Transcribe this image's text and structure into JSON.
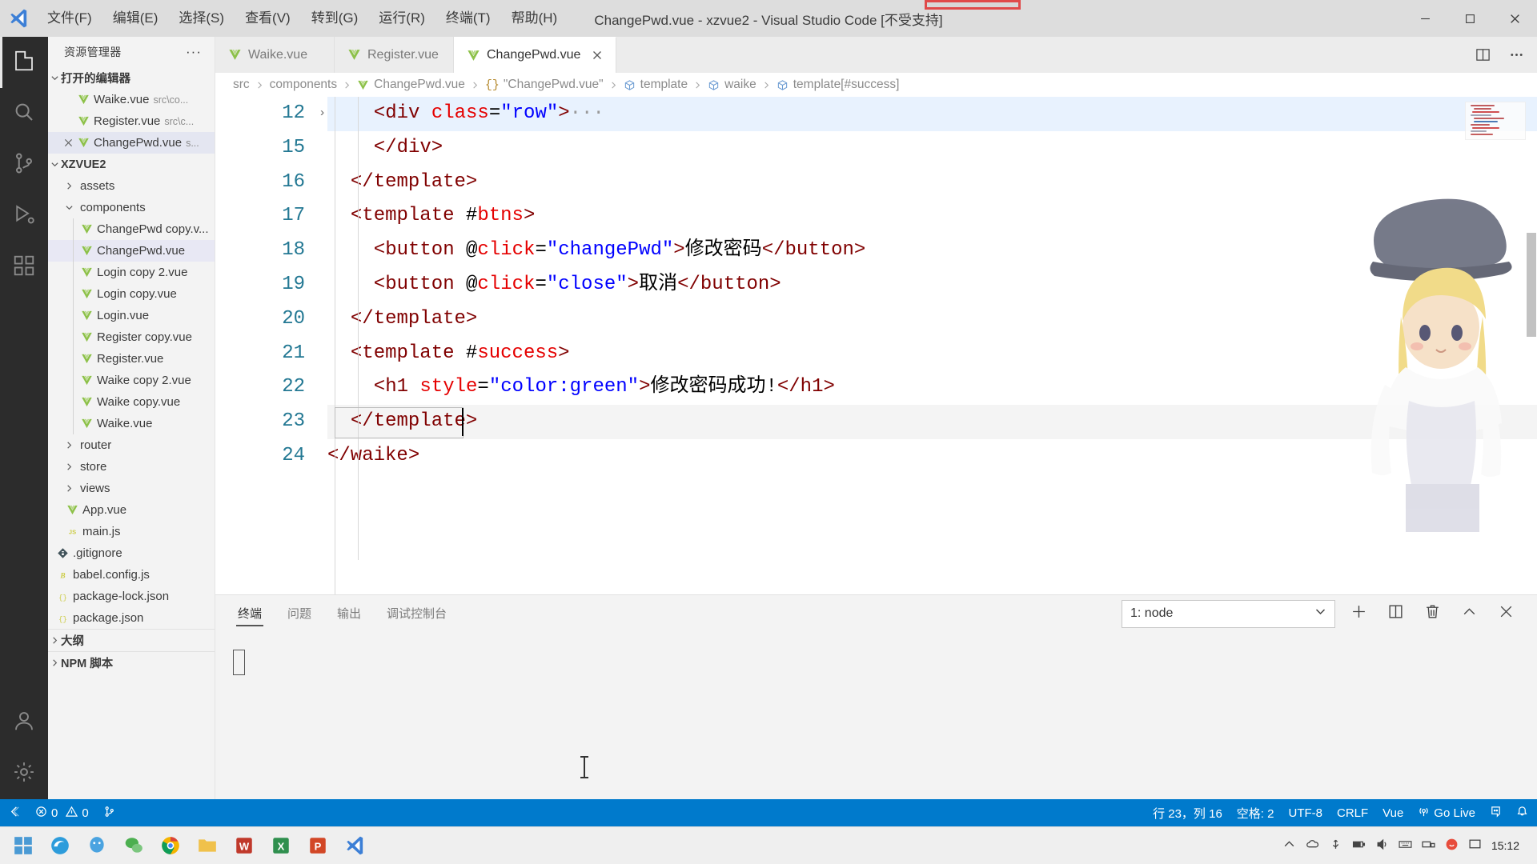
{
  "window": {
    "title": "ChangePwd.vue - xzvue2 - Visual Studio Code [不受支持]",
    "minimize": "─",
    "maximize": "□",
    "close": "✕"
  },
  "menu": [
    {
      "label": "文件(F)"
    },
    {
      "label": "编辑(E)"
    },
    {
      "label": "选择(S)"
    },
    {
      "label": "查看(V)"
    },
    {
      "label": "转到(G)"
    },
    {
      "label": "运行(R)"
    },
    {
      "label": "终端(T)"
    },
    {
      "label": "帮助(H)"
    }
  ],
  "activitybar": [
    {
      "name": "explorer-icon",
      "title": "资源管理器"
    },
    {
      "name": "search-icon",
      "title": "搜索"
    },
    {
      "name": "source-control-icon",
      "title": "源代码管理"
    },
    {
      "name": "run-debug-icon",
      "title": "运行和调试"
    },
    {
      "name": "extensions-icon",
      "title": "扩展"
    },
    {
      "name": "account-icon",
      "title": "账户"
    },
    {
      "name": "settings-gear-icon",
      "title": "管理"
    }
  ],
  "sidebar": {
    "header": "资源管理器",
    "header_more": "···",
    "open_editors": {
      "label": "打开的编辑器",
      "items": [
        {
          "name": "Waike.vue",
          "path": "src\\co...",
          "closable": false,
          "selected": false
        },
        {
          "name": "Register.vue",
          "path": "src\\c...",
          "closable": false,
          "selected": false
        },
        {
          "name": "ChangePwd.vue",
          "path": "s...",
          "closable": true,
          "selected": true
        }
      ]
    },
    "project": {
      "label": "XZVUE2",
      "items": [
        {
          "label": "assets",
          "type": "folder",
          "expanded": false,
          "indent": 1
        },
        {
          "label": "components",
          "type": "folder",
          "expanded": true,
          "indent": 1
        },
        {
          "label": "ChangePwd copy.v...",
          "type": "vue",
          "indent": 2
        },
        {
          "label": "ChangePwd.vue",
          "type": "vue",
          "indent": 2,
          "selected": true
        },
        {
          "label": "Login copy 2.vue",
          "type": "vue",
          "indent": 2
        },
        {
          "label": "Login copy.vue",
          "type": "vue",
          "indent": 2
        },
        {
          "label": "Login.vue",
          "type": "vue",
          "indent": 2
        },
        {
          "label": "Register copy.vue",
          "type": "vue",
          "indent": 2
        },
        {
          "label": "Register.vue",
          "type": "vue",
          "indent": 2
        },
        {
          "label": "Waike copy 2.vue",
          "type": "vue",
          "indent": 2
        },
        {
          "label": "Waike copy.vue",
          "type": "vue",
          "indent": 2
        },
        {
          "label": "Waike.vue",
          "type": "vue",
          "indent": 2
        },
        {
          "label": "router",
          "type": "folder",
          "expanded": false,
          "indent": 1
        },
        {
          "label": "store",
          "type": "folder",
          "expanded": false,
          "indent": 1
        },
        {
          "label": "views",
          "type": "folder",
          "expanded": false,
          "indent": 1
        },
        {
          "label": "App.vue",
          "type": "vue",
          "indent": 1
        },
        {
          "label": "main.js",
          "type": "js",
          "indent": 1
        },
        {
          "label": ".gitignore",
          "type": "git",
          "indent": 0
        },
        {
          "label": "babel.config.js",
          "type": "babel",
          "indent": 0
        },
        {
          "label": "package-lock.json",
          "type": "json",
          "indent": 0
        },
        {
          "label": "package.json",
          "type": "json",
          "indent": 0
        }
      ]
    },
    "outline": {
      "label": "大纲"
    },
    "npm_scripts": {
      "label": "NPM 脚本"
    }
  },
  "tabs": [
    {
      "label": "Waike.vue",
      "active": false,
      "closable": false
    },
    {
      "label": "Register.vue",
      "active": false,
      "closable": false
    },
    {
      "label": "ChangePwd.vue",
      "active": true,
      "closable": true
    }
  ],
  "tab_actions": [
    {
      "name": "split-editor-icon"
    },
    {
      "name": "more-actions-icon",
      "label": "···"
    }
  ],
  "breadcrumb": [
    {
      "label": "src",
      "icon": "none"
    },
    {
      "label": "components",
      "icon": "none"
    },
    {
      "label": "ChangePwd.vue",
      "icon": "vue"
    },
    {
      "label": "\"ChangePwd.vue\"",
      "icon": "braces"
    },
    {
      "label": "template",
      "icon": "symbol"
    },
    {
      "label": "waike",
      "icon": "symbol"
    },
    {
      "label": "template[#success]",
      "icon": "symbol"
    }
  ],
  "code": {
    "language": "Vue",
    "lines": [
      {
        "num": "12",
        "folded": true,
        "highlight": true,
        "indent": 2,
        "tokens": [
          {
            "t": "tag",
            "v": "<div "
          },
          {
            "t": "attr",
            "v": "class"
          },
          {
            "t": "punc",
            "v": "="
          },
          {
            "t": "val",
            "v": "\"row\""
          },
          {
            "t": "tag",
            "v": ">"
          },
          {
            "t": "dots",
            "v": "···"
          }
        ]
      },
      {
        "num": "15",
        "indent": 2,
        "tokens": [
          {
            "t": "tag",
            "v": "</div>"
          }
        ]
      },
      {
        "num": "16",
        "indent": 1,
        "tokens": [
          {
            "t": "tag",
            "v": "</template>"
          }
        ]
      },
      {
        "num": "17",
        "indent": 1,
        "tokens": [
          {
            "t": "tag",
            "v": "<template "
          },
          {
            "t": "punc",
            "v": "#"
          },
          {
            "t": "attr",
            "v": "btns"
          },
          {
            "t": "tag",
            "v": ">"
          }
        ]
      },
      {
        "num": "18",
        "indent": 2,
        "tokens": [
          {
            "t": "tag",
            "v": "<button "
          },
          {
            "t": "punc",
            "v": "@"
          },
          {
            "t": "attr",
            "v": "click"
          },
          {
            "t": "punc",
            "v": "="
          },
          {
            "t": "val",
            "v": "\"changePwd\""
          },
          {
            "t": "tag",
            "v": ">"
          },
          {
            "t": "txt",
            "v": "修改密码"
          },
          {
            "t": "tag",
            "v": "</button>"
          }
        ]
      },
      {
        "num": "19",
        "indent": 2,
        "tokens": [
          {
            "t": "tag",
            "v": "<button "
          },
          {
            "t": "punc",
            "v": "@"
          },
          {
            "t": "attr",
            "v": "click"
          },
          {
            "t": "punc",
            "v": "="
          },
          {
            "t": "val",
            "v": "\"close\""
          },
          {
            "t": "tag",
            "v": ">"
          },
          {
            "t": "txt",
            "v": "取消"
          },
          {
            "t": "tag",
            "v": "</button>"
          }
        ]
      },
      {
        "num": "20",
        "indent": 1,
        "tokens": [
          {
            "t": "tag",
            "v": "</template>"
          }
        ]
      },
      {
        "num": "21",
        "indent": 1,
        "tokens": [
          {
            "t": "tag",
            "v": "<template "
          },
          {
            "t": "punc",
            "v": "#"
          },
          {
            "t": "attr",
            "v": "success"
          },
          {
            "t": "tag",
            "v": ">"
          }
        ]
      },
      {
        "num": "22",
        "indent": 2,
        "tokens": [
          {
            "t": "tag",
            "v": "<h1 "
          },
          {
            "t": "attr",
            "v": "style"
          },
          {
            "t": "punc",
            "v": "="
          },
          {
            "t": "val",
            "v": "\"color:green\""
          },
          {
            "t": "tag",
            "v": ">"
          },
          {
            "t": "txt",
            "v": "修改密码成功!"
          },
          {
            "t": "tag",
            "v": "</h1>"
          }
        ]
      },
      {
        "num": "23",
        "indent": 1,
        "current": true,
        "tokens": [
          {
            "t": "tag",
            "v": "</template>"
          }
        ]
      },
      {
        "num": "24",
        "indent": 0,
        "tokens": [
          {
            "t": "tag",
            "v": "</waike>"
          }
        ]
      }
    ]
  },
  "panel": {
    "tabs": [
      {
        "label": "终端",
        "active": true
      },
      {
        "label": "问题",
        "active": false
      },
      {
        "label": "输出",
        "active": false
      },
      {
        "label": "调试控制台",
        "active": false
      }
    ],
    "terminal_select": "1: node",
    "actions": [
      {
        "name": "new-terminal-icon"
      },
      {
        "name": "split-terminal-icon"
      },
      {
        "name": "kill-terminal-icon"
      },
      {
        "name": "maximize-panel-icon"
      },
      {
        "name": "close-panel-icon"
      }
    ],
    "content": ""
  },
  "statusbar": {
    "remote": "remote-icon",
    "problems": {
      "errors": "0",
      "warnings": "0"
    },
    "branch_icon": "source-control-icon",
    "right": [
      {
        "label": "行 23，列 16",
        "name": "cursor-position"
      },
      {
        "label": "空格: 2",
        "name": "indentation"
      },
      {
        "label": "UTF-8",
        "name": "encoding"
      },
      {
        "label": "CRLF",
        "name": "eol"
      },
      {
        "label": "Vue",
        "name": "language-mode"
      },
      {
        "label": "Go Live",
        "name": "go-live",
        "icon": "broadcast-icon"
      },
      {
        "label": "",
        "name": "feedback-icon",
        "icon": "smiley-icon"
      },
      {
        "label": "",
        "name": "notifications-icon",
        "icon": "bell-icon"
      }
    ]
  },
  "taskbar": {
    "items": [
      {
        "name": "start-icon"
      },
      {
        "name": "edge-icon"
      },
      {
        "name": "qq-icon"
      },
      {
        "name": "wechat-icon"
      },
      {
        "name": "chrome-icon"
      },
      {
        "name": "folder-icon"
      },
      {
        "name": "word-icon"
      },
      {
        "name": "excel-icon"
      },
      {
        "name": "powerpoint-icon"
      },
      {
        "name": "vscode-icon"
      }
    ],
    "tray": [
      {
        "name": "chevron-up-icon"
      },
      {
        "name": "onedrive-icon"
      },
      {
        "name": "usb-icon"
      },
      {
        "name": "battery-icon"
      },
      {
        "name": "volume-icon"
      },
      {
        "name": "keyboard-icon"
      },
      {
        "name": "network-icon"
      },
      {
        "name": "sogou-icon"
      }
    ],
    "time": "15:12"
  }
}
